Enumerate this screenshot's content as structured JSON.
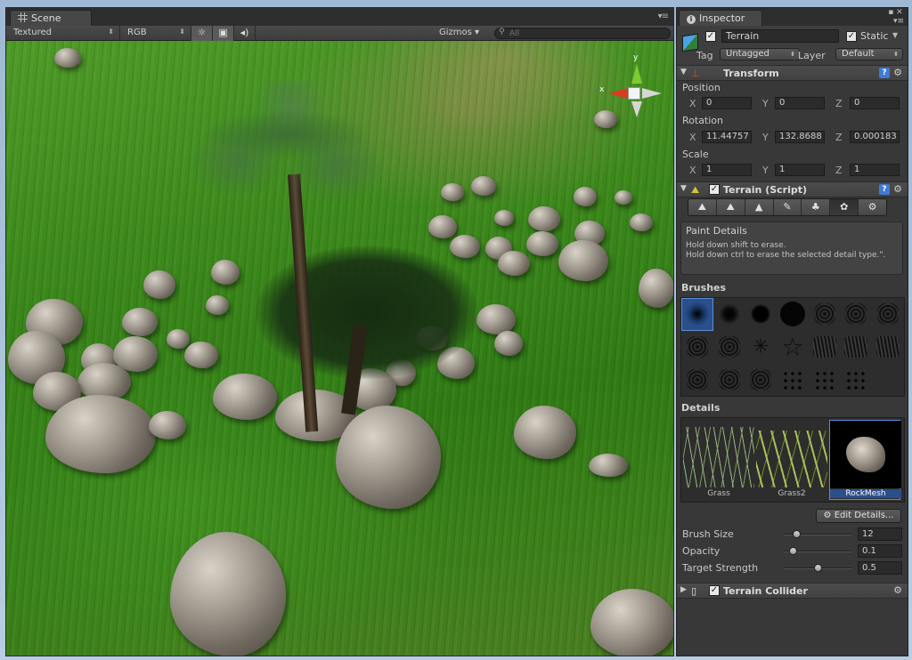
{
  "scene": {
    "tab_label": "Scene",
    "toolbar": {
      "render_mode": "Textured",
      "color_mode": "RGB",
      "gizmos_label": "Gizmos",
      "search_placeholder": "All"
    },
    "gizmo": {
      "y_label": "y",
      "x_label": "x"
    }
  },
  "inspector": {
    "tab_label": "Inspector",
    "gameobject": {
      "active_check": "✓",
      "name": "Terrain",
      "static_check": "✓",
      "static_label": "Static",
      "tag_label": "Tag",
      "tag_value": "Untagged",
      "layer_label": "Layer",
      "layer_value": "Default"
    },
    "transform": {
      "title": "Transform",
      "position_label": "Position",
      "rotation_label": "Rotation",
      "scale_label": "Scale",
      "axis_x": "X",
      "axis_y": "Y",
      "axis_z": "Z",
      "position": {
        "x": "0",
        "y": "0",
        "z": "0"
      },
      "rotation": {
        "x": "11.44757",
        "y": "132.8688",
        "z": "0.000183"
      },
      "scale": {
        "x": "1",
        "y": "1",
        "z": "1"
      }
    },
    "terrain": {
      "title": "Terrain (Script)",
      "enabled_check": "✓",
      "help_title": "Paint Details",
      "help_line1": "Hold down shift to erase.",
      "help_line2": "Hold down ctrl to erase the selected detail type.\".",
      "brushes_title": "Brushes",
      "details_title": "Details",
      "details": [
        "Grass",
        "Grass2",
        "RockMesh"
      ],
      "selected_detail": "RockMesh",
      "edit_details_label": "Edit Details...",
      "settings": {
        "brush_size_label": "Brush Size",
        "brush_size_value": "12",
        "opacity_label": "Opacity",
        "opacity_value": "0.1",
        "target_strength_label": "Target Strength",
        "target_strength_value": "0.5"
      }
    },
    "collider": {
      "title": "Terrain Collider",
      "enabled_check": "✓"
    }
  },
  "colors": {
    "panel_bg": "#383838",
    "selection": "#2a4f8a",
    "help_button": "#3e7bd6"
  }
}
